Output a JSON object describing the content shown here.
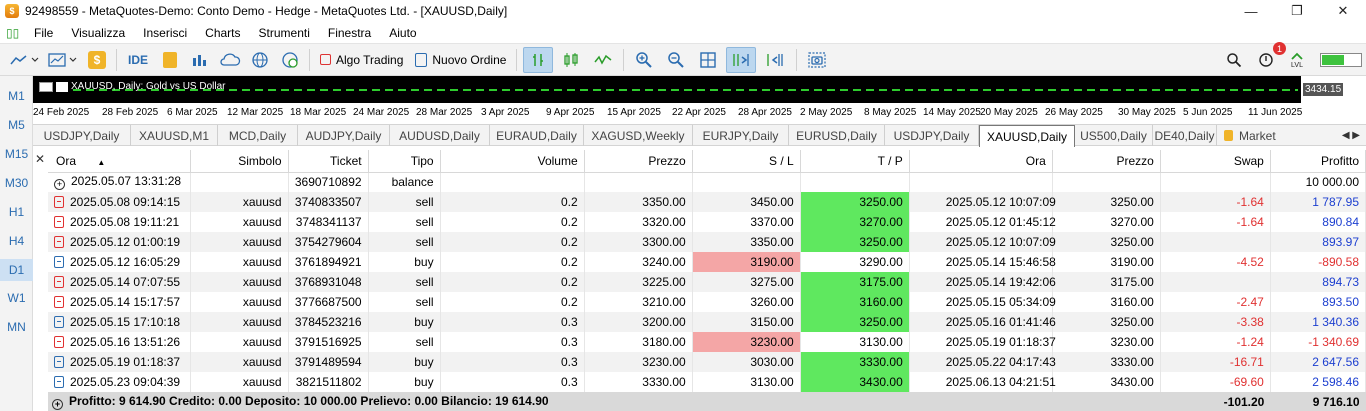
{
  "window": {
    "title": "92498559 - MetaQuotes-Demo: Conto Demo - Hedge - MetaQuotes Ltd. - [XAUUSD,Daily]",
    "minimize_glyph": "—",
    "restore_glyph": "❐",
    "close_glyph": "✕"
  },
  "menu": [
    "File",
    "Visualizza",
    "Inserisci",
    "Charts",
    "Strumenti",
    "Finestra",
    "Aiuto"
  ],
  "toolbar": {
    "ide_label": "IDE",
    "algo_trading_label": "Algo Trading",
    "new_order_label": "Nuovo Ordine",
    "notification_count": "1",
    "signal_level": 0.55,
    "coin_label": "$",
    "lvl_label": "LVL"
  },
  "timeframes": [
    "M1",
    "M5",
    "M15",
    "M30",
    "H1",
    "H4",
    "D1",
    "W1",
    "MN"
  ],
  "active_timeframe": "D1",
  "chart": {
    "label": "XAUUSD, Daily:  Gold vs US Dollar",
    "price_tag": "3434.15",
    "dates": [
      "24 Feb 2025",
      "28 Feb 2025",
      "6 Mar 2025",
      "12 Mar 2025",
      "18 Mar 2025",
      "24 Mar 2025",
      "28 Mar 2025",
      "3 Apr 2025",
      "9 Apr 2025",
      "15 Apr 2025",
      "22 Apr 2025",
      "28 Apr 2025",
      "2 May 2025",
      "8 May 2025",
      "14 May 2025",
      "20 May 2025",
      "26 May 2025",
      "30 May 2025",
      "5 Jun 2025",
      "11 Jun 2025"
    ],
    "line_color": "#2ecc2e"
  },
  "symbol_tabs": [
    "USDJPY,Daily",
    "XAUUSD,M1",
    "MCD,Daily",
    "AUDJPY,Daily",
    "AUDUSD,Daily",
    "EURAUD,Daily",
    "XAGUSD,Weekly",
    "EURJPY,Daily",
    "EURUSD,Daily",
    "USDJPY,Daily",
    "XAUUSD,Daily",
    "US500,Daily",
    "DE40,Daily"
  ],
  "active_symbol_tab": "XAUUSD,Daily",
  "market_tab": "Market",
  "tab_arrows": "◀ ▶",
  "table": {
    "sort_indicator": "▲",
    "columns": [
      "Ora",
      "Simbolo",
      "Ticket",
      "Tipo",
      "Volume",
      "Prezzo",
      "S / L",
      "T / P",
      "Ora",
      "Prezzo",
      "Swap",
      "Profitto"
    ],
    "balance_row": {
      "time": "2025.05.07 13:31:28",
      "ticket": "3690710892",
      "type": "balance",
      "profit": "10 000.00"
    },
    "rows": [
      {
        "time": "2025.05.08 09:14:15",
        "symbol": "xauusd",
        "ticket": "3740833507",
        "type": "sell",
        "volume": "0.2",
        "price": "3350.00",
        "sl": "3450.00",
        "tp": "3250.00",
        "hit": "tp",
        "close_time": "2025.05.12 10:07:09",
        "close_price": "3250.00",
        "swap": "-1.64",
        "profit": "1 787.95"
      },
      {
        "time": "2025.05.08 19:11:21",
        "symbol": "xauusd",
        "ticket": "3748341137",
        "type": "sell",
        "volume": "0.2",
        "price": "3320.00",
        "sl": "3370.00",
        "tp": "3270.00",
        "hit": "tp",
        "close_time": "2025.05.12 01:45:12",
        "close_price": "3270.00",
        "swap": "-1.64",
        "profit": "890.84"
      },
      {
        "time": "2025.05.12 01:00:19",
        "symbol": "xauusd",
        "ticket": "3754279604",
        "type": "sell",
        "volume": "0.2",
        "price": "3300.00",
        "sl": "3350.00",
        "tp": "3250.00",
        "hit": "tp",
        "close_time": "2025.05.12 10:07:09",
        "close_price": "3250.00",
        "swap": "",
        "profit": "893.97"
      },
      {
        "time": "2025.05.12 16:05:29",
        "symbol": "xauusd",
        "ticket": "3761894921",
        "type": "buy",
        "volume": "0.2",
        "price": "3240.00",
        "sl": "3190.00",
        "tp": "3290.00",
        "hit": "sl",
        "close_time": "2025.05.14 15:46:58",
        "close_price": "3190.00",
        "swap": "-4.52",
        "profit": "-890.58"
      },
      {
        "time": "2025.05.14 07:07:55",
        "symbol": "xauusd",
        "ticket": "3768931048",
        "type": "sell",
        "volume": "0.2",
        "price": "3225.00",
        "sl": "3275.00",
        "tp": "3175.00",
        "hit": "tp",
        "close_time": "2025.05.14 19:42:06",
        "close_price": "3175.00",
        "swap": "",
        "profit": "894.73"
      },
      {
        "time": "2025.05.14 15:17:57",
        "symbol": "xauusd",
        "ticket": "3776687500",
        "type": "sell",
        "volume": "0.2",
        "price": "3210.00",
        "sl": "3260.00",
        "tp": "3160.00",
        "hit": "tp",
        "close_time": "2025.05.15 05:34:09",
        "close_price": "3160.00",
        "swap": "-2.47",
        "profit": "893.50"
      },
      {
        "time": "2025.05.15 17:10:18",
        "symbol": "xauusd",
        "ticket": "3784523216",
        "type": "buy",
        "volume": "0.3",
        "price": "3200.00",
        "sl": "3150.00",
        "tp": "3250.00",
        "hit": "tp",
        "close_time": "2025.05.16 01:41:46",
        "close_price": "3250.00",
        "swap": "-3.38",
        "profit": "1 340.36"
      },
      {
        "time": "2025.05.16 13:51:26",
        "symbol": "xauusd",
        "ticket": "3791516925",
        "type": "sell",
        "volume": "0.3",
        "price": "3180.00",
        "sl": "3230.00",
        "tp": "3130.00",
        "hit": "sl",
        "close_time": "2025.05.19 01:18:37",
        "close_price": "3230.00",
        "swap": "-1.24",
        "profit": "-1 340.69"
      },
      {
        "time": "2025.05.19 01:18:37",
        "symbol": "xauusd",
        "ticket": "3791489594",
        "type": "buy",
        "volume": "0.3",
        "price": "3230.00",
        "sl": "3030.00",
        "tp": "3330.00",
        "hit": "tp",
        "close_time": "2025.05.22 04:17:43",
        "close_price": "3330.00",
        "swap": "-16.71",
        "profit": "2 647.56"
      },
      {
        "time": "2025.05.23 09:04:39",
        "symbol": "xauusd",
        "ticket": "3821511802",
        "type": "buy",
        "volume": "0.3",
        "price": "3330.00",
        "sl": "3130.00",
        "tp": "3430.00",
        "hit": "tp",
        "close_time": "2025.06.13 04:21:51",
        "close_price": "3430.00",
        "swap": "-69.60",
        "profit": "2 598.46"
      }
    ],
    "summary": {
      "text": "Profitto: 9 614.90  Credito: 0.00  Deposito: 10 000.00  Prelievo: 0.00  Bilancio: 19 614.90",
      "swap_total": "-101.20",
      "profit_total": "9 716.10"
    }
  }
}
